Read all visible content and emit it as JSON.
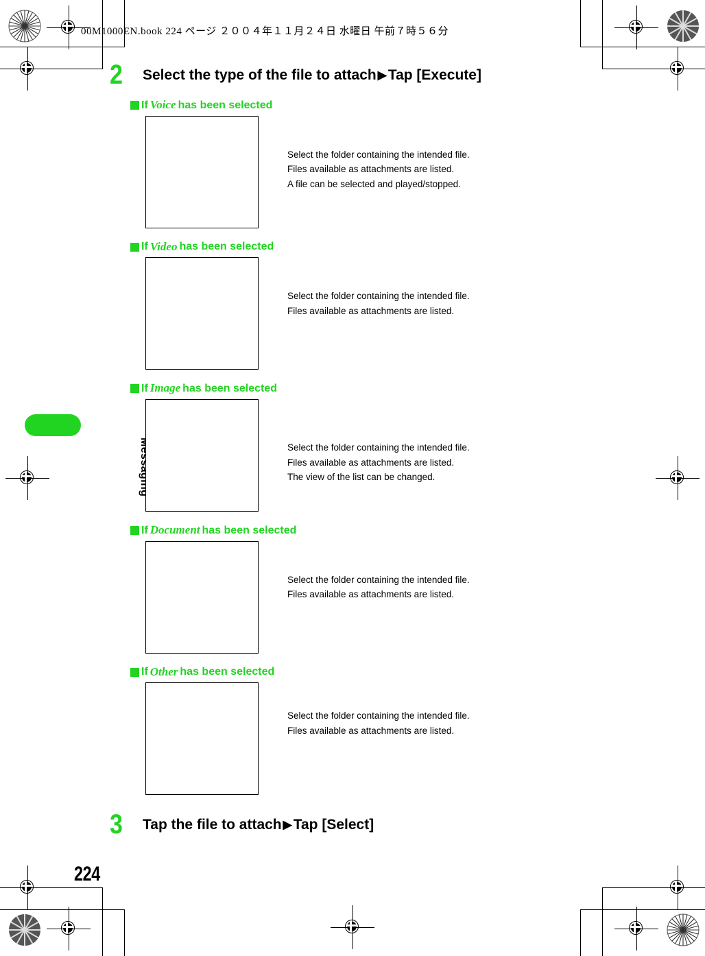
{
  "document": {
    "slugline": "00M1000EN.book   224 ページ   ２００４年１１月２４日   水曜日   午前７時５６分",
    "page_number": "224",
    "chapter_tab_label": "Messaging"
  },
  "colors": {
    "accent_green": "#22d422",
    "text_black": "#000000",
    "page_background": "#ffffff"
  },
  "steps": [
    {
      "number": "2",
      "title_before": "Select the type of the file to attach",
      "arrow": "▶",
      "title_after": "Tap [Execute]"
    },
    {
      "number": "3",
      "title_before": "Tap the file to attach",
      "arrow": "▶",
      "title_after": "Tap [Select]"
    }
  ],
  "sections": [
    {
      "id": "voice",
      "prefix": "If",
      "emphasis": "Voice",
      "suffix": "has been selected",
      "screenshot_alt": "voice-folder-list-screenshot",
      "caption": [
        "Select the folder containing the intended file.",
        "Files available as attachments are listed.",
        "A file can be selected and played/stopped."
      ]
    },
    {
      "id": "video",
      "prefix": "If",
      "emphasis": "Video",
      "suffix": "has been selected",
      "screenshot_alt": "video-folder-list-screenshot",
      "caption": [
        "Select the folder containing the intended file.",
        "Files available as attachments are listed."
      ]
    },
    {
      "id": "image",
      "prefix": "If",
      "emphasis": "Image",
      "suffix": "has been selected",
      "screenshot_alt": "image-folder-list-screenshot",
      "caption": [
        "Select the folder containing the intended file.",
        "Files available as attachments are listed.",
        "The view of the list can be changed."
      ]
    },
    {
      "id": "document",
      "prefix": "If",
      "emphasis": "Document",
      "suffix": "has been selected",
      "screenshot_alt": "document-folder-list-screenshot",
      "caption": [
        "Select the folder containing the intended file.",
        "Files available as attachments are listed."
      ]
    },
    {
      "id": "other",
      "prefix": "If",
      "emphasis": "Other",
      "suffix": "has been selected",
      "screenshot_alt": "other-folder-list-screenshot",
      "caption": [
        "Select the folder containing the intended file.",
        "Files available as attachments are listed."
      ]
    }
  ]
}
